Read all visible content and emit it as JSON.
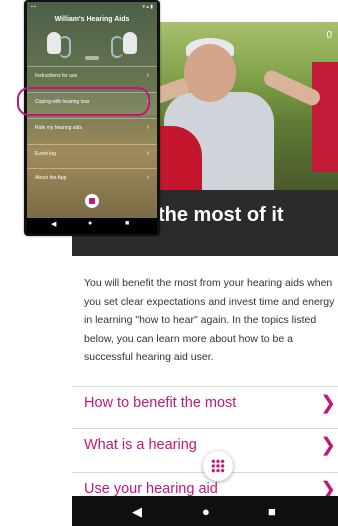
{
  "back_screen": {
    "status_time": "0",
    "title": "the most of it",
    "intro": "You will benefit the most from your hearing aids when you set clear expectations and invest time and energy in learning \"how to hear\" again. In the topics listed below, you can learn more about how to be a successful hearing aid user.",
    "topics": [
      {
        "label": "How to benefit the most",
        "icon": "chevron-right-icon"
      },
      {
        "label": "What is a hearing",
        "icon": "chevron-right-icon"
      },
      {
        "label": "Use your hearing aid",
        "icon": "chevron-right-icon"
      }
    ],
    "nav": {
      "back": "◀",
      "home": "●",
      "recents": "■"
    }
  },
  "front_screen": {
    "title": "William's Hearing Aids",
    "menu": [
      {
        "label": "Instructions for use",
        "sub": ""
      },
      {
        "label": "Coping with hearing loss",
        "sub": ""
      },
      {
        "label": "Ride my hearing aids",
        "sub": ""
      },
      {
        "label": "Event log",
        "sub": ""
      },
      {
        "label": "About the App",
        "sub": ""
      }
    ],
    "nav": {
      "back": "◀",
      "home": "●",
      "recents": "■"
    }
  },
  "colors": {
    "accent": "#c2177a",
    "title_band": "#2b2b2b",
    "nav": "#0f0f0f"
  }
}
